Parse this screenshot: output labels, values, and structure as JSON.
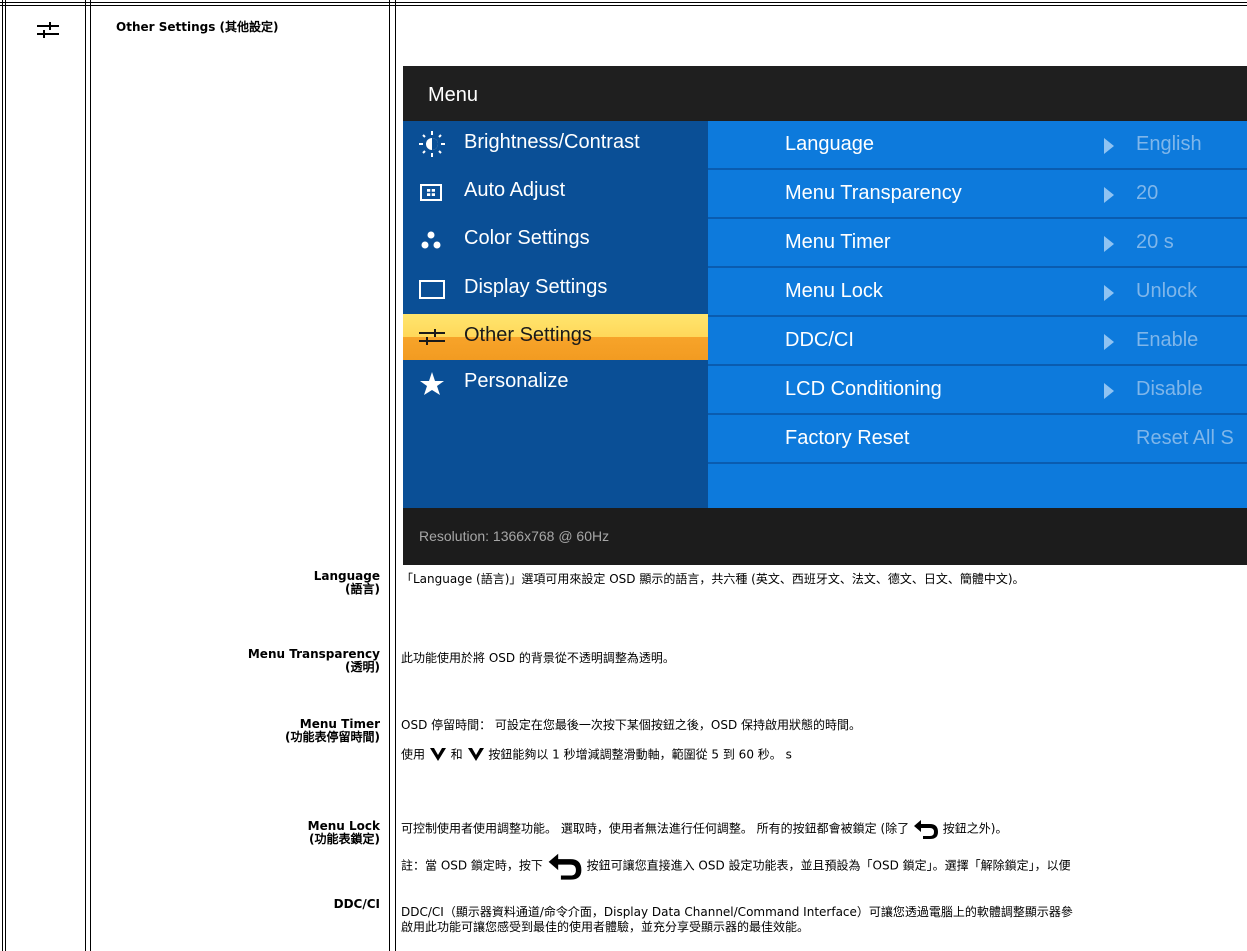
{
  "section": {
    "icon": "other-settings-icon",
    "title": "Other Settings (其他設定)"
  },
  "osd": {
    "title": "Menu",
    "menu": [
      {
        "label": "Brightness/Contrast",
        "icon": "brightness-icon",
        "selected": false
      },
      {
        "label": "Auto Adjust",
        "icon": "auto-adjust-icon",
        "selected": false
      },
      {
        "label": "Color Settings",
        "icon": "color-settings-icon",
        "selected": false
      },
      {
        "label": "Display Settings",
        "icon": "display-settings-icon",
        "selected": false
      },
      {
        "label": "Other Settings",
        "icon": "other-settings-icon",
        "selected": true
      },
      {
        "label": "Personalize",
        "icon": "star-icon",
        "selected": false
      }
    ],
    "rows": [
      {
        "label": "Language",
        "value": "English",
        "arrow": true
      },
      {
        "label": "Menu Transparency",
        "value": "20",
        "arrow": true
      },
      {
        "label": "Menu Timer",
        "value": "20 s",
        "arrow": true
      },
      {
        "label": "Menu Lock",
        "value": "Unlock",
        "arrow": true
      },
      {
        "label": "DDC/CI",
        "value": "Enable",
        "arrow": true
      },
      {
        "label": "LCD Conditioning",
        "value": "Disable",
        "arrow": true
      },
      {
        "label": "Factory Reset",
        "value": "Reset All S",
        "arrow": false
      }
    ],
    "resolution": "Resolution: 1366x768 @ 60Hz",
    "colors": {
      "left_panel": "#0a4f96",
      "right_panel": "#0d7adc",
      "selected": "#f7a42a",
      "header": "#1f1f1f"
    }
  },
  "items": {
    "language": {
      "term": "Language",
      "term_zh": "(語言)",
      "desc": "「Language (語言)」選項可用來設定 OSD 顯示的語言，共六種 (英文、西班牙文、法文、德文、日文、簡體中文)。"
    },
    "transparency": {
      "term": "Menu Transparency",
      "term_zh": "(透明)",
      "desc": "此功能使用於將 OSD 的背景從不透明調整為透明。"
    },
    "timer": {
      "term": "Menu Timer",
      "term_zh": "(功能表停留時間)",
      "desc1": "OSD 停留時間： 可設定在您最後一次按下某個按鈕之後，OSD 保持啟用狀態的時間。",
      "desc2_a": "使用",
      "desc2_b": "和",
      "desc2_c": "按鈕能夠以 1 秒增減調整滑動軸，範圍從 5 到 60 秒。 s"
    },
    "lock": {
      "term": "Menu Lock",
      "term_zh": "(功能表鎖定)",
      "desc1_a": "可控制使用者使用調整功能。 選取時，使用者無法進行任何調整。 所有的按鈕都會被鎖定 (除了",
      "desc1_b": "按鈕之外)。",
      "note_a": "註：當 OSD 鎖定時，按下",
      "note_b": "按鈕可讓您直接進入 OSD 設定功能表，並且預設為「OSD 鎖定」。選擇「解除鎖定」，以便"
    },
    "ddc": {
      "term": "DDC/CI",
      "desc1": "DDC/CI（顯示器資料通道/命令介面，Display Data Channel/Command Interface）可讓您透過電腦上的軟體調整顯示器參",
      "desc2": "啟用此功能可讓您感受到最佳的使用者體驗，並充分享受顯示器的最佳效能。"
    }
  }
}
